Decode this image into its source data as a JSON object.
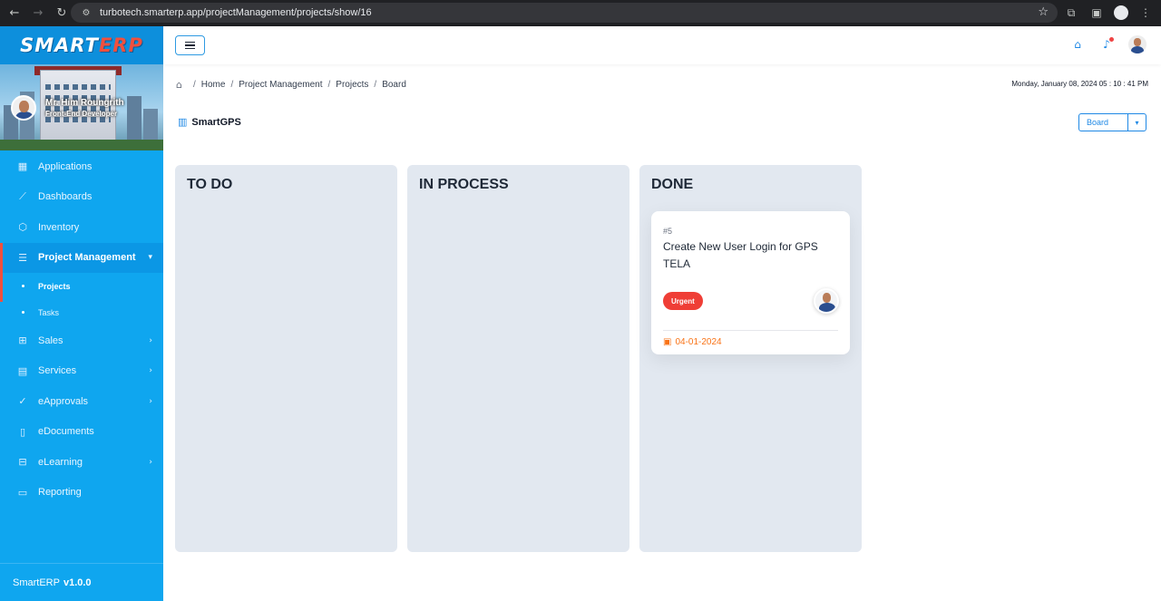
{
  "browser": {
    "url": "turbotech.smarterp.app/projectManagement/projects/show/16"
  },
  "sidebar": {
    "logo_main": "SMART",
    "logo_accent": "ERP",
    "user_name": "Mr. Him Roungrith",
    "user_role": "Front-End Developer",
    "items": [
      {
        "label": "Applications",
        "icon": "grid-icon"
      },
      {
        "label": "Dashboards",
        "icon": "chart-line-icon"
      },
      {
        "label": "Inventory",
        "icon": "box-icon"
      },
      {
        "label": "Project Management",
        "icon": "tasks-icon"
      },
      {
        "label": "Sales",
        "icon": "sales-icon"
      },
      {
        "label": "Services",
        "icon": "services-icon"
      },
      {
        "label": "eApprovals",
        "icon": "check-circle-icon"
      },
      {
        "label": "eDocuments",
        "icon": "document-icon"
      },
      {
        "label": "eLearning",
        "icon": "learning-icon"
      },
      {
        "label": "Reporting",
        "icon": "report-icon"
      }
    ],
    "subitems": [
      {
        "label": "Projects"
      },
      {
        "label": "Tasks"
      }
    ],
    "version_label": "SmartERP",
    "version_number": "v1.0.0"
  },
  "breadcrumb": {
    "items": [
      "Home",
      "Project Management",
      "Projects",
      "Board"
    ]
  },
  "datetime": "Monday, January 08, 2024  05 : 10 : 41 PM",
  "board": {
    "title": "SmartGPS",
    "view_selected": "Board"
  },
  "columns": [
    {
      "title": "TO DO"
    },
    {
      "title": "IN PROCESS"
    },
    {
      "title": "DONE"
    }
  ],
  "card": {
    "id": "#5",
    "title": "Create New User Login for GPS TELA",
    "priority": "Urgent",
    "date": "04-01-2024"
  },
  "colors": {
    "sidebar": "#0fa6ef",
    "accent": "#1e88e5",
    "urgent": "#ef3e36",
    "date": "#f97316"
  }
}
